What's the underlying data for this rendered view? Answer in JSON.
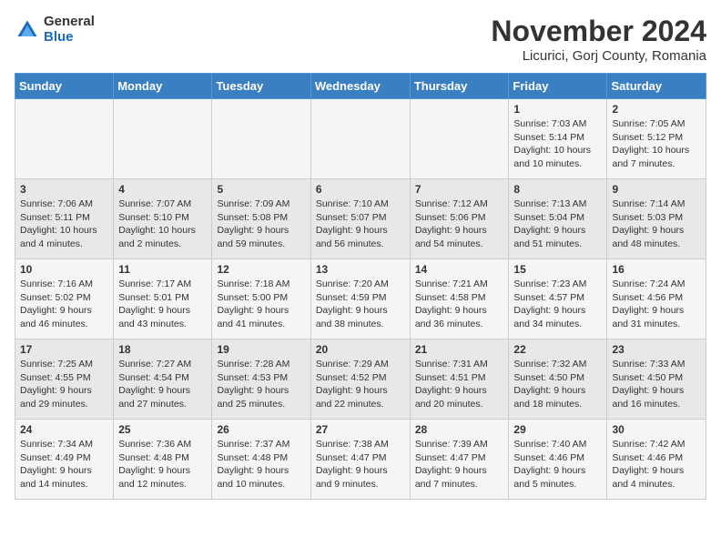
{
  "header": {
    "logo_general": "General",
    "logo_blue": "Blue",
    "main_title": "November 2024",
    "subtitle": "Licurici, Gorj County, Romania"
  },
  "calendar": {
    "columns": [
      "Sunday",
      "Monday",
      "Tuesday",
      "Wednesday",
      "Thursday",
      "Friday",
      "Saturday"
    ],
    "weeks": [
      [
        {
          "day": "",
          "info": ""
        },
        {
          "day": "",
          "info": ""
        },
        {
          "day": "",
          "info": ""
        },
        {
          "day": "",
          "info": ""
        },
        {
          "day": "",
          "info": ""
        },
        {
          "day": "1",
          "info": "Sunrise: 7:03 AM\nSunset: 5:14 PM\nDaylight: 10 hours and 10 minutes."
        },
        {
          "day": "2",
          "info": "Sunrise: 7:05 AM\nSunset: 5:12 PM\nDaylight: 10 hours and 7 minutes."
        }
      ],
      [
        {
          "day": "3",
          "info": "Sunrise: 7:06 AM\nSunset: 5:11 PM\nDaylight: 10 hours and 4 minutes."
        },
        {
          "day": "4",
          "info": "Sunrise: 7:07 AM\nSunset: 5:10 PM\nDaylight: 10 hours and 2 minutes."
        },
        {
          "day": "5",
          "info": "Sunrise: 7:09 AM\nSunset: 5:08 PM\nDaylight: 9 hours and 59 minutes."
        },
        {
          "day": "6",
          "info": "Sunrise: 7:10 AM\nSunset: 5:07 PM\nDaylight: 9 hours and 56 minutes."
        },
        {
          "day": "7",
          "info": "Sunrise: 7:12 AM\nSunset: 5:06 PM\nDaylight: 9 hours and 54 minutes."
        },
        {
          "day": "8",
          "info": "Sunrise: 7:13 AM\nSunset: 5:04 PM\nDaylight: 9 hours and 51 minutes."
        },
        {
          "day": "9",
          "info": "Sunrise: 7:14 AM\nSunset: 5:03 PM\nDaylight: 9 hours and 48 minutes."
        }
      ],
      [
        {
          "day": "10",
          "info": "Sunrise: 7:16 AM\nSunset: 5:02 PM\nDaylight: 9 hours and 46 minutes."
        },
        {
          "day": "11",
          "info": "Sunrise: 7:17 AM\nSunset: 5:01 PM\nDaylight: 9 hours and 43 minutes."
        },
        {
          "day": "12",
          "info": "Sunrise: 7:18 AM\nSunset: 5:00 PM\nDaylight: 9 hours and 41 minutes."
        },
        {
          "day": "13",
          "info": "Sunrise: 7:20 AM\nSunset: 4:59 PM\nDaylight: 9 hours and 38 minutes."
        },
        {
          "day": "14",
          "info": "Sunrise: 7:21 AM\nSunset: 4:58 PM\nDaylight: 9 hours and 36 minutes."
        },
        {
          "day": "15",
          "info": "Sunrise: 7:23 AM\nSunset: 4:57 PM\nDaylight: 9 hours and 34 minutes."
        },
        {
          "day": "16",
          "info": "Sunrise: 7:24 AM\nSunset: 4:56 PM\nDaylight: 9 hours and 31 minutes."
        }
      ],
      [
        {
          "day": "17",
          "info": "Sunrise: 7:25 AM\nSunset: 4:55 PM\nDaylight: 9 hours and 29 minutes."
        },
        {
          "day": "18",
          "info": "Sunrise: 7:27 AM\nSunset: 4:54 PM\nDaylight: 9 hours and 27 minutes."
        },
        {
          "day": "19",
          "info": "Sunrise: 7:28 AM\nSunset: 4:53 PM\nDaylight: 9 hours and 25 minutes."
        },
        {
          "day": "20",
          "info": "Sunrise: 7:29 AM\nSunset: 4:52 PM\nDaylight: 9 hours and 22 minutes."
        },
        {
          "day": "21",
          "info": "Sunrise: 7:31 AM\nSunset: 4:51 PM\nDaylight: 9 hours and 20 minutes."
        },
        {
          "day": "22",
          "info": "Sunrise: 7:32 AM\nSunset: 4:50 PM\nDaylight: 9 hours and 18 minutes."
        },
        {
          "day": "23",
          "info": "Sunrise: 7:33 AM\nSunset: 4:50 PM\nDaylight: 9 hours and 16 minutes."
        }
      ],
      [
        {
          "day": "24",
          "info": "Sunrise: 7:34 AM\nSunset: 4:49 PM\nDaylight: 9 hours and 14 minutes."
        },
        {
          "day": "25",
          "info": "Sunrise: 7:36 AM\nSunset: 4:48 PM\nDaylight: 9 hours and 12 minutes."
        },
        {
          "day": "26",
          "info": "Sunrise: 7:37 AM\nSunset: 4:48 PM\nDaylight: 9 hours and 10 minutes."
        },
        {
          "day": "27",
          "info": "Sunrise: 7:38 AM\nSunset: 4:47 PM\nDaylight: 9 hours and 9 minutes."
        },
        {
          "day": "28",
          "info": "Sunrise: 7:39 AM\nSunset: 4:47 PM\nDaylight: 9 hours and 7 minutes."
        },
        {
          "day": "29",
          "info": "Sunrise: 7:40 AM\nSunset: 4:46 PM\nDaylight: 9 hours and 5 minutes."
        },
        {
          "day": "30",
          "info": "Sunrise: 7:42 AM\nSunset: 4:46 PM\nDaylight: 9 hours and 4 minutes."
        }
      ]
    ]
  }
}
